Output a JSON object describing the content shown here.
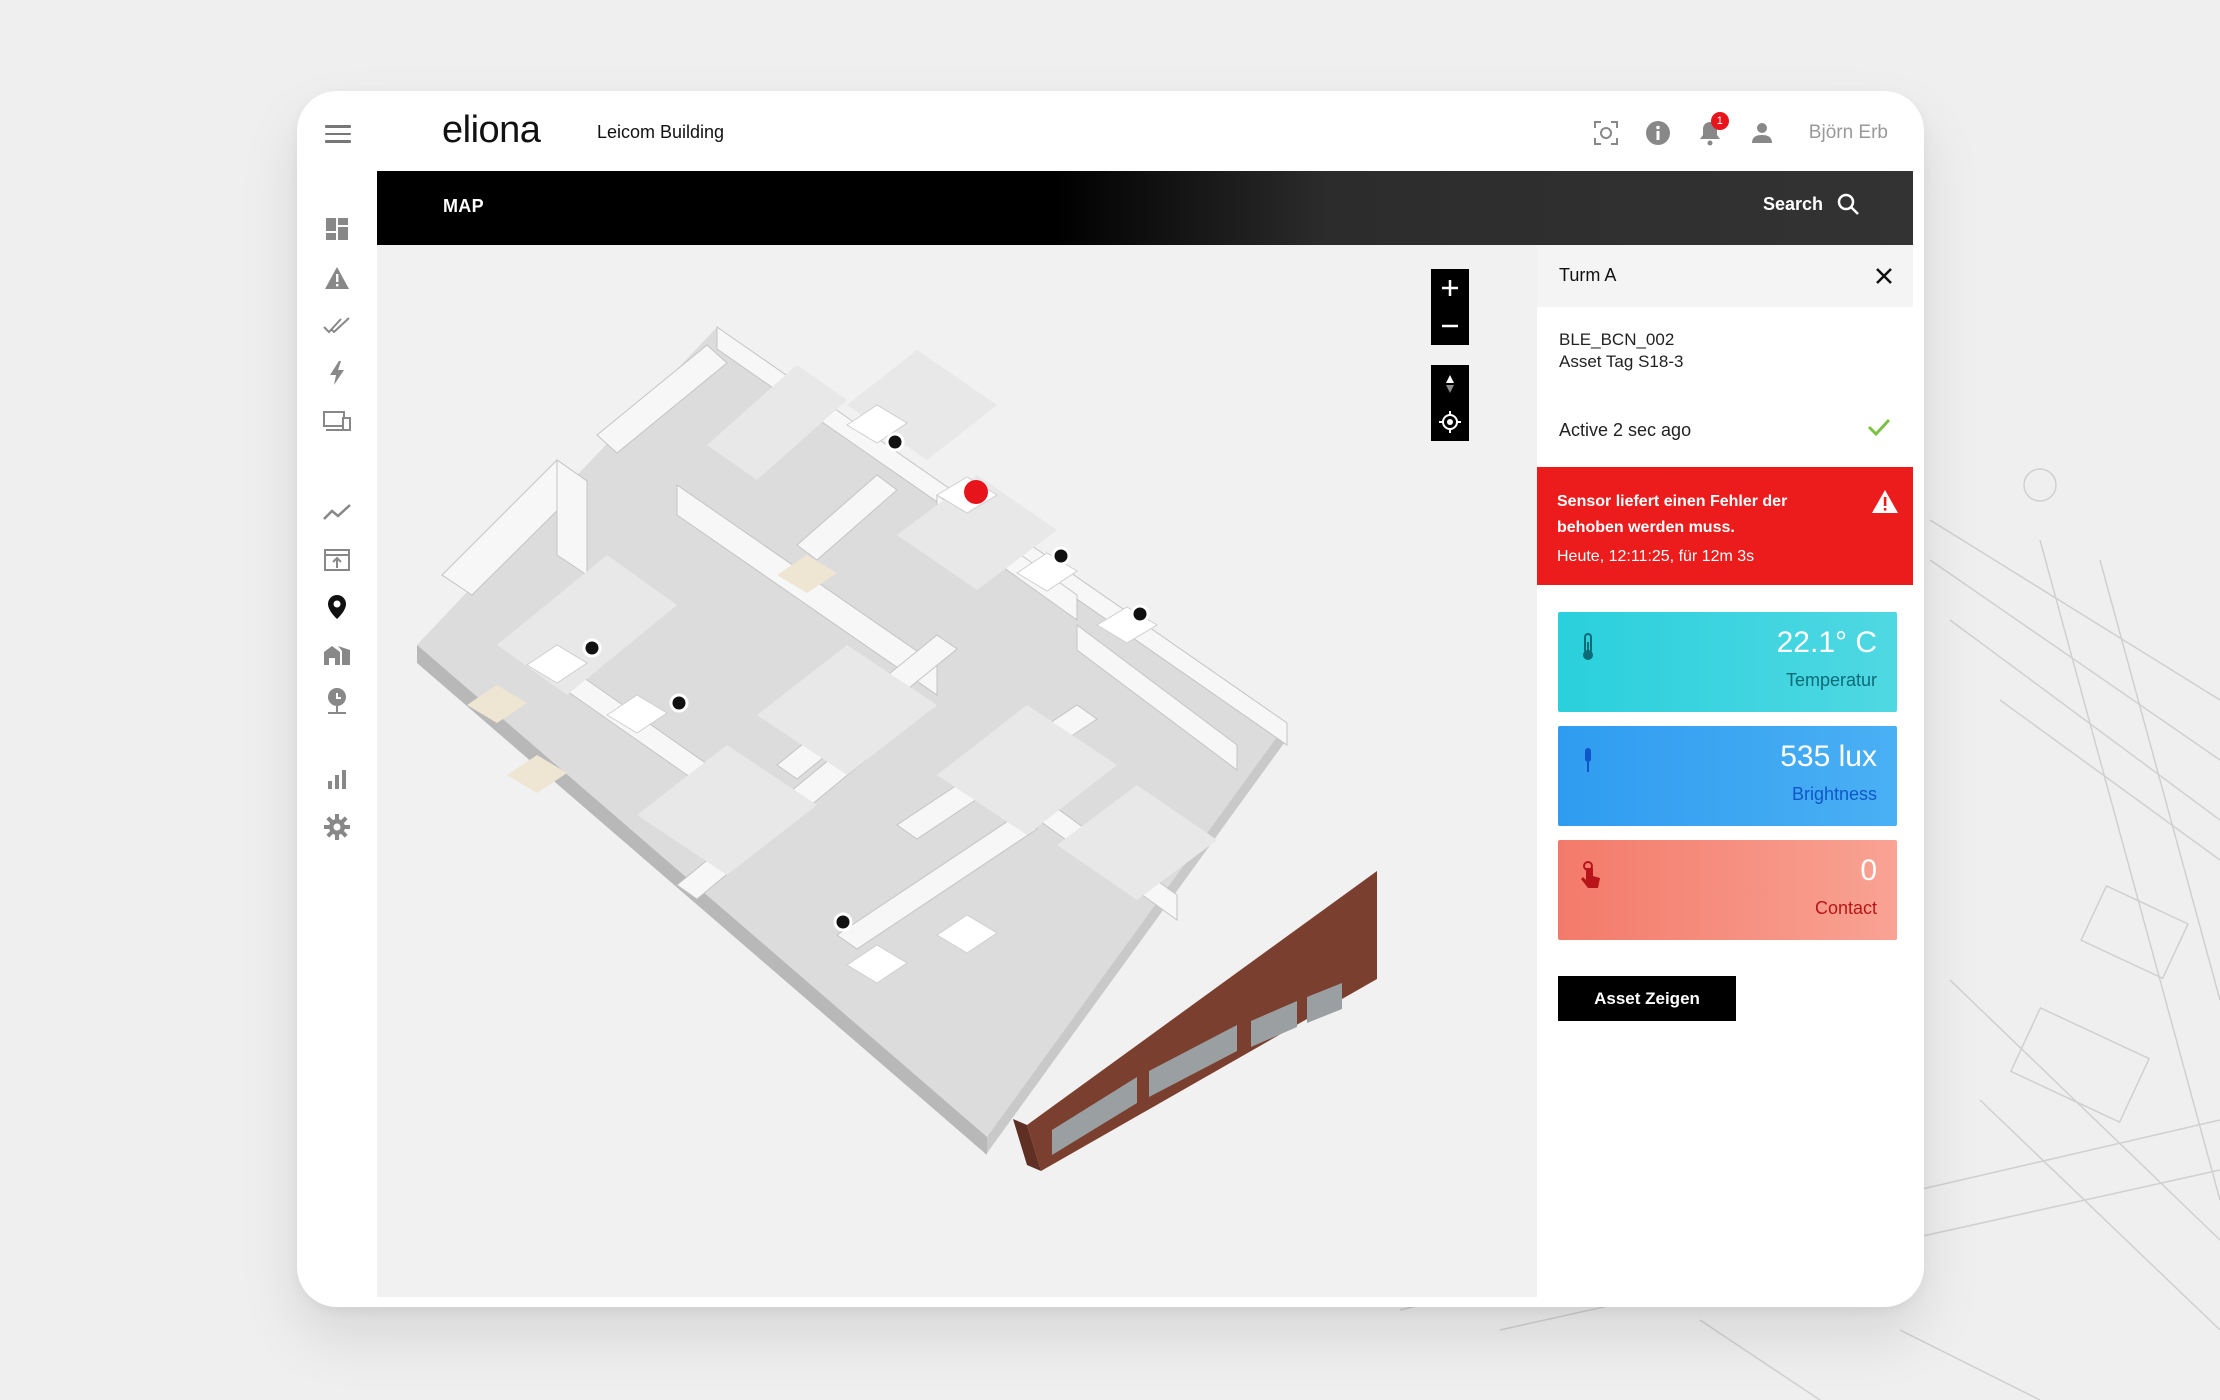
{
  "app": {
    "logo": "eliona",
    "building": "Leicom Building"
  },
  "header": {
    "username": "Björn Erb",
    "notification_count": "1"
  },
  "mapbar": {
    "title": "MAP",
    "search_label": "Search"
  },
  "sidebar": {
    "items": [
      {
        "icon": "dashboard-icon"
      },
      {
        "icon": "alert-triangle-icon"
      },
      {
        "icon": "double-check-icon"
      },
      {
        "icon": "lightning-icon"
      },
      {
        "icon": "devices-icon"
      },
      {
        "icon": "trend-line-icon"
      },
      {
        "icon": "upload-icon"
      },
      {
        "icon": "map-pin-icon"
      },
      {
        "icon": "buildings-icon"
      },
      {
        "icon": "location-stand-icon"
      },
      {
        "icon": "bar-chart-icon"
      },
      {
        "icon": "gear-icon"
      }
    ]
  },
  "panel": {
    "title": "Turm A",
    "asset_id": "BLE_BCN_002",
    "asset_tag": "Asset Tag S18-3",
    "status": "Active 2 sec ago",
    "alert": {
      "message": "Sensor liefert einen Fehler der behoben werden muss.",
      "time": "Heute, 12:11:25, für 12m 3s"
    },
    "tiles": [
      {
        "value": "22.1° C",
        "label": "Temperatur",
        "icon": "thermometer-icon",
        "color": "#2ad0dd"
      },
      {
        "value": "535 lux",
        "label": "Brightness",
        "icon": "light-sensor-icon",
        "color": "#2f9cf0"
      },
      {
        "value": "0",
        "label": "Contact",
        "icon": "touch-icon",
        "color": "#f37a6a"
      }
    ],
    "button": "Asset Zeigen"
  },
  "colors": {
    "alert": "#ec1c1c",
    "accent_check": "#7cc242"
  }
}
